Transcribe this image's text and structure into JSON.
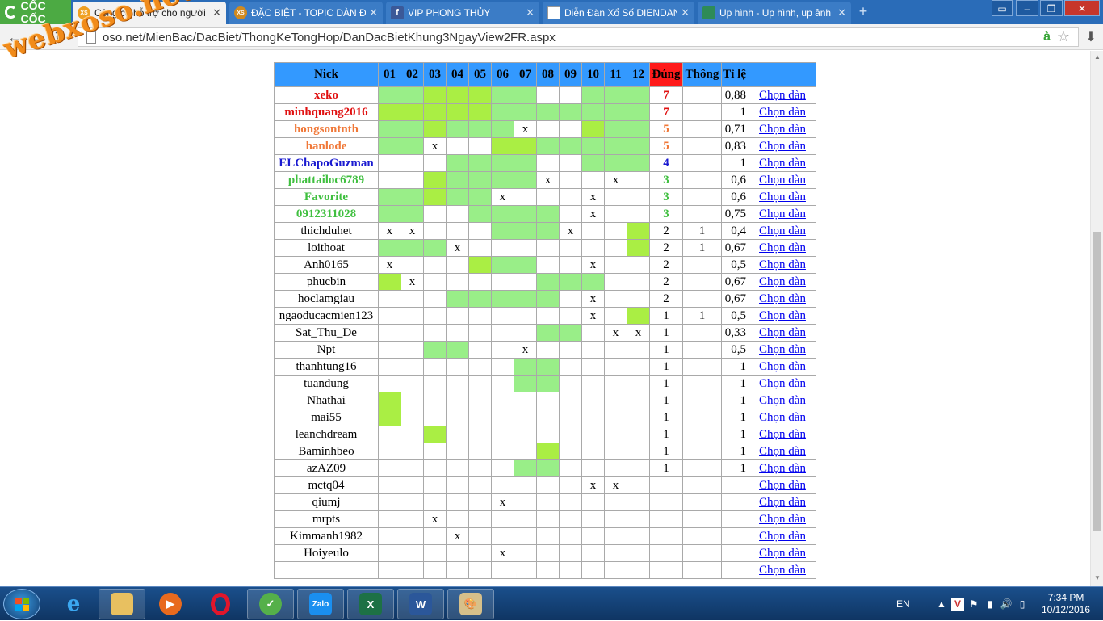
{
  "browser": {
    "brand": "CỐC CỐC",
    "tabs": [
      {
        "label": "Công cụ hỗ trợ cho người",
        "icon": "xoso-icon",
        "active": true
      },
      {
        "label": "ĐẶC BIỆT - TOPIC DÀN ĐẶ",
        "icon": "xoso-icon",
        "active": false
      },
      {
        "label": "VIP PHONG THỦY",
        "icon": "facebook-icon",
        "active": false
      },
      {
        "label": "Diễn Đàn Xổ Số DIENDAN",
        "icon": "page-icon",
        "active": false
      },
      {
        "label": "Up hình - Up hình, up ảnh",
        "icon": "image-icon",
        "active": false
      }
    ],
    "url": "oso.net/MienBac/DacBiet/ThongKeTongHop/DanDacBietKhung3NgayView2FR.aspx"
  },
  "watermark": "webxoso.net",
  "table": {
    "headers": [
      "Nick",
      "01",
      "02",
      "03",
      "04",
      "05",
      "06",
      "07",
      "08",
      "09",
      "10",
      "11",
      "12",
      "Đúng",
      "Thông",
      "Tỉ lệ",
      ""
    ],
    "rows": [
      {
        "nick": "xeko",
        "color": "#e01010",
        "bold": true,
        "cells": [
          "g",
          "g",
          "y",
          "y",
          "y",
          "g",
          "g",
          "",
          "",
          "g",
          "g",
          "g"
        ],
        "dung": "7",
        "thong": "",
        "tile": "0,88",
        "link": "Chọn dàn"
      },
      {
        "nick": "minhquang2016",
        "color": "#e01010",
        "bold": true,
        "cells": [
          "y",
          "y",
          "y",
          "y",
          "y",
          "g",
          "g",
          "g",
          "g",
          "g",
          "g",
          "g"
        ],
        "dung": "7",
        "thong": "",
        "tile": "1",
        "link": "Chọn dàn"
      },
      {
        "nick": "hongsontnth",
        "color": "#f07838",
        "bold": true,
        "cells": [
          "g",
          "g",
          "y",
          "g",
          "g",
          "g",
          "x",
          "",
          "",
          "y",
          "g",
          "g"
        ],
        "dung": "5",
        "thong": "",
        "tile": "0,71",
        "link": "Chọn dàn"
      },
      {
        "nick": "hanlode",
        "color": "#f07838",
        "bold": true,
        "cells": [
          "g",
          "g",
          "x",
          "",
          "",
          "y",
          "y",
          "g",
          "g",
          "g",
          "g",
          "g"
        ],
        "dung": "5",
        "thong": "",
        "tile": "0,83",
        "link": "Chọn dàn"
      },
      {
        "nick": "ELChapoGuzman",
        "color": "#1a1ad0",
        "bold": true,
        "cells": [
          "",
          "",
          "",
          "g",
          "g",
          "g",
          "g",
          "",
          "",
          "g",
          "g",
          "g"
        ],
        "dung": "4",
        "thong": "",
        "tile": "1",
        "link": "Chọn dàn"
      },
      {
        "nick": "phattailoc6789",
        "color": "#3fbf3f",
        "bold": true,
        "cells": [
          "",
          "",
          "y",
          "g",
          "g",
          "g",
          "g",
          "x",
          "",
          "",
          "x",
          ""
        ],
        "dung": "3",
        "thong": "",
        "tile": "0,6",
        "link": "Chọn dàn"
      },
      {
        "nick": "Favorite",
        "color": "#3fbf3f",
        "bold": true,
        "cells": [
          "g",
          "g",
          "y",
          "g",
          "g",
          "x",
          "",
          "",
          "",
          "x",
          "",
          ""
        ],
        "dung": "3",
        "thong": "",
        "tile": "0,6",
        "link": "Chọn dàn"
      },
      {
        "nick": "0912311028",
        "color": "#3fbf3f",
        "bold": true,
        "cells": [
          "g",
          "g",
          "",
          "",
          "g",
          "g",
          "g",
          "g",
          "",
          "x",
          "",
          ""
        ],
        "dung": "3",
        "thong": "",
        "tile": "0,75",
        "link": "Chọn dàn"
      },
      {
        "nick": "thichduhet",
        "color": "#000000",
        "bold": false,
        "cells": [
          "x",
          "x",
          "",
          "",
          "",
          "g",
          "g",
          "g",
          "x",
          "",
          "",
          "y"
        ],
        "dung": "2",
        "thong": "1",
        "tile": "0,4",
        "link": "Chọn dàn"
      },
      {
        "nick": "loithoat",
        "color": "#000000",
        "bold": false,
        "cells": [
          "g",
          "g",
          "g",
          "x",
          "",
          "",
          "",
          "",
          "",
          "",
          "",
          "y"
        ],
        "dung": "2",
        "thong": "1",
        "tile": "0,67",
        "link": "Chọn dàn"
      },
      {
        "nick": "Anh0165",
        "color": "#000000",
        "bold": false,
        "cells": [
          "x",
          "",
          "",
          "",
          "y",
          "g",
          "g",
          "",
          "",
          "x",
          "",
          ""
        ],
        "dung": "2",
        "thong": "",
        "tile": "0,5",
        "link": "Chọn dàn"
      },
      {
        "nick": "phucbin",
        "color": "#000000",
        "bold": false,
        "cells": [
          "y",
          "x",
          "",
          "",
          "",
          "",
          "",
          "g",
          "g",
          "g",
          "",
          ""
        ],
        "dung": "2",
        "thong": "",
        "tile": "0,67",
        "link": "Chọn dàn"
      },
      {
        "nick": "hoclamgiau",
        "color": "#000000",
        "bold": false,
        "cells": [
          "",
          "",
          "",
          "g",
          "g",
          "g",
          "g",
          "g",
          "",
          "x",
          "",
          ""
        ],
        "dung": "2",
        "thong": "",
        "tile": "0,67",
        "link": "Chọn dàn"
      },
      {
        "nick": "ngaoducacmien123",
        "color": "#000000",
        "bold": false,
        "cells": [
          "",
          "",
          "",
          "",
          "",
          "",
          "",
          "",
          "",
          "x",
          "",
          "y"
        ],
        "dung": "1",
        "thong": "1",
        "tile": "0,5",
        "link": "Chọn dàn"
      },
      {
        "nick": "Sat_Thu_De",
        "color": "#000000",
        "bold": false,
        "cells": [
          "",
          "",
          "",
          "",
          "",
          "",
          "",
          "g",
          "g",
          "",
          "x",
          "x"
        ],
        "dung": "1",
        "thong": "",
        "tile": "0,33",
        "link": "Chọn dàn"
      },
      {
        "nick": "Npt",
        "color": "#000000",
        "bold": false,
        "cells": [
          "",
          "",
          "g",
          "g",
          "",
          "",
          "x",
          "",
          "",
          "",
          "",
          ""
        ],
        "dung": "1",
        "thong": "",
        "tile": "0,5",
        "link": "Chọn dàn"
      },
      {
        "nick": "thanhtung16",
        "color": "#000000",
        "bold": false,
        "cells": [
          "",
          "",
          "",
          "",
          "",
          "",
          "g",
          "g",
          "",
          "",
          "",
          ""
        ],
        "dung": "1",
        "thong": "",
        "tile": "1",
        "link": "Chọn dàn"
      },
      {
        "nick": "tuandung",
        "color": "#000000",
        "bold": false,
        "cells": [
          "",
          "",
          "",
          "",
          "",
          "",
          "g",
          "g",
          "",
          "",
          "",
          ""
        ],
        "dung": "1",
        "thong": "",
        "tile": "1",
        "link": "Chọn dàn"
      },
      {
        "nick": "Nhathai",
        "color": "#000000",
        "bold": false,
        "cells": [
          "y",
          "",
          "",
          "",
          "",
          "",
          "",
          "",
          "",
          "",
          "",
          ""
        ],
        "dung": "1",
        "thong": "",
        "tile": "1",
        "link": "Chọn dàn"
      },
      {
        "nick": "mai55",
        "color": "#000000",
        "bold": false,
        "cells": [
          "y",
          "",
          "",
          "",
          "",
          "",
          "",
          "",
          "",
          "",
          "",
          ""
        ],
        "dung": "1",
        "thong": "",
        "tile": "1",
        "link": "Chọn dàn"
      },
      {
        "nick": "leanchdream",
        "color": "#000000",
        "bold": false,
        "cells": [
          "",
          "",
          "y",
          "",
          "",
          "",
          "",
          "",
          "",
          "",
          "",
          ""
        ],
        "dung": "1",
        "thong": "",
        "tile": "1",
        "link": "Chọn dàn"
      },
      {
        "nick": "Baminhbeo",
        "color": "#000000",
        "bold": false,
        "cells": [
          "",
          "",
          "",
          "",
          "",
          "",
          "",
          "y",
          "",
          "",
          "",
          ""
        ],
        "dung": "1",
        "thong": "",
        "tile": "1",
        "link": "Chọn dàn"
      },
      {
        "nick": "azAZ09",
        "color": "#000000",
        "bold": false,
        "cells": [
          "",
          "",
          "",
          "",
          "",
          "",
          "g",
          "g",
          "",
          "",
          "",
          ""
        ],
        "dung": "1",
        "thong": "",
        "tile": "1",
        "link": "Chọn dàn"
      },
      {
        "nick": "mctq04",
        "color": "#000000",
        "bold": false,
        "cells": [
          "",
          "",
          "",
          "",
          "",
          "",
          "",
          "",
          "",
          "x",
          "x",
          ""
        ],
        "dung": "",
        "thong": "",
        "tile": "",
        "link": "Chọn dàn"
      },
      {
        "nick": "qiumj",
        "color": "#000000",
        "bold": false,
        "cells": [
          "",
          "",
          "",
          "",
          "",
          "x",
          "",
          "",
          "",
          "",
          "",
          ""
        ],
        "dung": "",
        "thong": "",
        "tile": "",
        "link": "Chọn dàn"
      },
      {
        "nick": "mrpts",
        "color": "#000000",
        "bold": false,
        "cells": [
          "",
          "",
          "x",
          "",
          "",
          "",
          "",
          "",
          "",
          "",
          "",
          ""
        ],
        "dung": "",
        "thong": "",
        "tile": "",
        "link": "Chọn dàn"
      },
      {
        "nick": "Kimmanh1982",
        "color": "#000000",
        "bold": false,
        "cells": [
          "",
          "",
          "",
          "x",
          "",
          "",
          "",
          "",
          "",
          "",
          "",
          ""
        ],
        "dung": "",
        "thong": "",
        "tile": "",
        "link": "Chọn dàn"
      },
      {
        "nick": "Hoiyeulo",
        "color": "#000000",
        "bold": false,
        "cells": [
          "",
          "",
          "",
          "",
          "",
          "x",
          "",
          "",
          "",
          "",
          "",
          ""
        ],
        "dung": "",
        "thong": "",
        "tile": "",
        "link": "Chọn dàn"
      },
      {
        "nick": "",
        "color": "#000000",
        "bold": false,
        "cells": [
          "",
          "",
          "",
          "",
          "",
          "",
          "",
          "",
          "",
          "",
          "",
          ""
        ],
        "dung": "",
        "thong": "",
        "tile": "",
        "link": "Chọn dàn"
      }
    ]
  },
  "taskbar": {
    "apps": [
      "windows-explorer-icon",
      "media-player-icon",
      "opera-icon",
      "coccoc-icon",
      "zalo-icon",
      "excel-icon",
      "word-icon",
      "paint-icon"
    ],
    "zalo_label": "Zalo",
    "language": "EN",
    "time": "7:34 PM",
    "date": "10/12/2016"
  },
  "colors": {
    "header": "#3399ff",
    "header_highlight": "#ff1a1a",
    "cell_green": "#99ee88",
    "cell_yellow_green": "#aaee44",
    "link": "#0000ee"
  }
}
